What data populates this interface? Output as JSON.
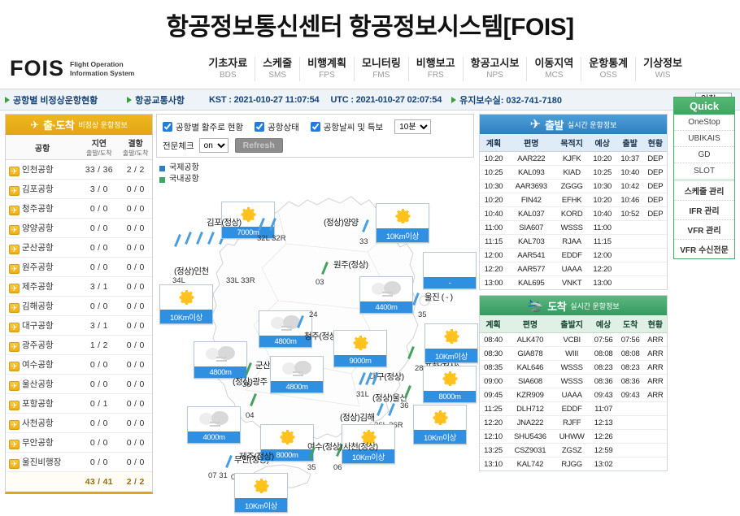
{
  "banner": {
    "title": "항공정보통신센터 항공정보시스템[FOIS]"
  },
  "header": {
    "logo_main": "FOIS",
    "logo_sub_line1": "Flight Operation",
    "logo_sub_line2": "Information System",
    "nav": [
      {
        "ko": "기초자료",
        "en": "BDS"
      },
      {
        "ko": "스케줄",
        "en": "SMS"
      },
      {
        "ko": "비행계획",
        "en": "FPS"
      },
      {
        "ko": "모니터링",
        "en": "FMS"
      },
      {
        "ko": "비행보고",
        "en": "FRS"
      },
      {
        "ko": "항공고시보",
        "en": "NPS"
      },
      {
        "ko": "이동지역",
        "en": "MCS"
      },
      {
        "ko": "운항통계",
        "en": "OSS"
      },
      {
        "ko": "기상정보",
        "en": "WIS"
      }
    ]
  },
  "statusbar": {
    "link1": "공항별 비정상운항현황",
    "link2": "항공교통사항",
    "kst": "KST : 2021-010-27 11:07:54",
    "utc": "UTC : 2021-010-27 02:07:54",
    "maintenance": "유지보수실: 032-741-7180",
    "airport_select": "인천"
  },
  "left_panel": {
    "head_title": "출·도착",
    "head_sub": "비정상 운항정보",
    "columns": {
      "airport": "공항",
      "delay": "지연",
      "cancel": "결항",
      "sub": "출발/도착"
    },
    "rows": [
      {
        "name": "인천공항",
        "delay": "33 / 36",
        "cancel": "2 / 2"
      },
      {
        "name": "김포공항",
        "delay": "3 / 0",
        "cancel": "0 / 0"
      },
      {
        "name": "청주공항",
        "delay": "0 / 0",
        "cancel": "0 / 0"
      },
      {
        "name": "양양공항",
        "delay": "0 / 0",
        "cancel": "0 / 0"
      },
      {
        "name": "군산공항",
        "delay": "0 / 0",
        "cancel": "0 / 0"
      },
      {
        "name": "원주공항",
        "delay": "0 / 0",
        "cancel": "0 / 0"
      },
      {
        "name": "제주공항",
        "delay": "3 / 1",
        "cancel": "0 / 0"
      },
      {
        "name": "김해공항",
        "delay": "0 / 0",
        "cancel": "0 / 0"
      },
      {
        "name": "대구공항",
        "delay": "3 / 1",
        "cancel": "0 / 0"
      },
      {
        "name": "광주공항",
        "delay": "1 / 2",
        "cancel": "0 / 0"
      },
      {
        "name": "여수공항",
        "delay": "0 / 0",
        "cancel": "0 / 0"
      },
      {
        "name": "울산공항",
        "delay": "0 / 0",
        "cancel": "0 / 0"
      },
      {
        "name": "포항공항",
        "delay": "0 / 1",
        "cancel": "0 / 0"
      },
      {
        "name": "사천공항",
        "delay": "0 / 0",
        "cancel": "0 / 0"
      },
      {
        "name": "무안공항",
        "delay": "0 / 0",
        "cancel": "0 / 0"
      },
      {
        "name": "울진비행장",
        "delay": "0 / 0",
        "cancel": "0 / 0"
      }
    ],
    "total": {
      "delay": "43 / 41",
      "cancel": "2 / 2"
    }
  },
  "filters": {
    "chk1": "공항별 활주로 현황",
    "chk2": "공항상태",
    "chk3": "공항날씨 및 특보",
    "interval": "10분",
    "telegram_label": "전문체크",
    "telegram_value": "on",
    "refresh": "Refresh",
    "legend_intl": "국제공항",
    "legend_dom": "국내공항"
  },
  "map": {
    "airports": [
      {
        "label": "(정상)인천",
        "vis": "10Km이상",
        "sky": "sun",
        "runways": "34L",
        "runways2": "33L  33R"
      },
      {
        "label": "김포(정상)",
        "vis": "7000m",
        "sky": "sun",
        "runways": "32L  32R"
      },
      {
        "label": "(정상)양양",
        "vis": "10Km이상",
        "sky": "sun",
        "runways": "33"
      },
      {
        "label": "원주(정상)",
        "vis": "4400m",
        "sky": "cloud",
        "runways": "03"
      },
      {
        "label": "청주(정상)",
        "vis": "4800m",
        "sky": "cloud",
        "runways": "24"
      },
      {
        "label": "울진 ( - )",
        "vis": "-",
        "sky": "blank",
        "runways": "35"
      },
      {
        "label": "포항(정상)",
        "vis": "10Km이상",
        "sky": "sun",
        "runways": "28"
      },
      {
        "label": "대구(정상)",
        "vis": "9000m",
        "sky": "sun",
        "runways": "31L"
      },
      {
        "label": "군산(정상)",
        "vis": "4800m",
        "sky": "cloud",
        "runways": "36"
      },
      {
        "label": "(정상)울산",
        "vis": "8000m",
        "sky": "sun",
        "runways": "36"
      },
      {
        "label": "(정상)김해",
        "vis": "10Km이상",
        "sky": "sun",
        "runways": "36L  36R"
      },
      {
        "label": "(정상)광주",
        "vis": "4800m",
        "sky": "cloud",
        "runways": "04"
      },
      {
        "label": "무안(정상)",
        "vis": "4000m",
        "sky": "cloud",
        "runways": "01"
      },
      {
        "label": "사천(정상)",
        "vis": "10Km이상",
        "sky": "sun",
        "runways": "06"
      },
      {
        "label": "여수(정상)",
        "vis": "8000m",
        "sky": "sun",
        "runways": "35"
      },
      {
        "label": "제주(정상)",
        "vis": "10Km이상",
        "sky": "sun",
        "runways": "07  31"
      }
    ]
  },
  "departures": {
    "head_title": "출발",
    "head_sub": "실시간 운항정보",
    "columns": [
      "계획",
      "편명",
      "목적지",
      "예상",
      "출발",
      "현황"
    ],
    "rows": [
      [
        "10:20",
        "AAR222",
        "KJFK",
        "10:20",
        "10:37",
        "DEP"
      ],
      [
        "10:25",
        "KAL093",
        "KIAD",
        "10:25",
        "10:40",
        "DEP"
      ],
      [
        "10:30",
        "AAR3693",
        "ZGGG",
        "10:30",
        "10:42",
        "DEP"
      ],
      [
        "10:20",
        "FIN42",
        "EFHK",
        "10:20",
        "10:46",
        "DEP"
      ],
      [
        "10:40",
        "KAL037",
        "KORD",
        "10:40",
        "10:52",
        "DEP"
      ],
      [
        "11:00",
        "SIA607",
        "WSSS",
        "11:00",
        "",
        ""
      ],
      [
        "11:15",
        "KAL703",
        "RJAA",
        "11:15",
        "",
        ""
      ],
      [
        "12:00",
        "AAR541",
        "EDDF",
        "12:00",
        "",
        ""
      ],
      [
        "12:20",
        "AAR577",
        "UAAA",
        "12:20",
        "",
        ""
      ],
      [
        "13:00",
        "KAL695",
        "VNKT",
        "13:00",
        "",
        ""
      ]
    ]
  },
  "arrivals": {
    "head_title": "도착",
    "head_sub": "실시간 운항정보",
    "columns": [
      "계획",
      "편명",
      "출발지",
      "예상",
      "도착",
      "현황"
    ],
    "rows": [
      [
        "08:40",
        "ALK470",
        "VCBI",
        "07:56",
        "07:56",
        "ARR"
      ],
      [
        "08:30",
        "GIA878",
        "WIII",
        "08:08",
        "08:08",
        "ARR"
      ],
      [
        "08:35",
        "KAL646",
        "WSSS",
        "08:23",
        "08:23",
        "ARR"
      ],
      [
        "09:00",
        "SIA608",
        "WSSS",
        "08:36",
        "08:36",
        "ARR"
      ],
      [
        "09:45",
        "KZR909",
        "UAAA",
        "09:43",
        "09:43",
        "ARR"
      ],
      [
        "11:25",
        "DLH712",
        "EDDF",
        "11:07",
        "",
        ""
      ],
      [
        "12:20",
        "JNA222",
        "RJFF",
        "12:13",
        "",
        ""
      ],
      [
        "12:10",
        "SHU5436",
        "UHWW",
        "12:26",
        "",
        ""
      ],
      [
        "13:25",
        "CSZ9031",
        "ZGSZ",
        "12:59",
        "",
        ""
      ],
      [
        "13:10",
        "KAL742",
        "RJGG",
        "13:02",
        "",
        ""
      ]
    ]
  },
  "quick": {
    "title": "Quick",
    "group1": [
      "OneStop",
      "UBIKAIS",
      "GD",
      "SLOT"
    ],
    "group2": [
      "스케줄 관리",
      "IFR 관리",
      "VFR 관리",
      "VFR 수신전문"
    ]
  },
  "colors": {
    "amber": "#e8ab17",
    "blue": "#2f7fc0",
    "green": "#359960",
    "vis_blue": "#2f8fe0"
  }
}
